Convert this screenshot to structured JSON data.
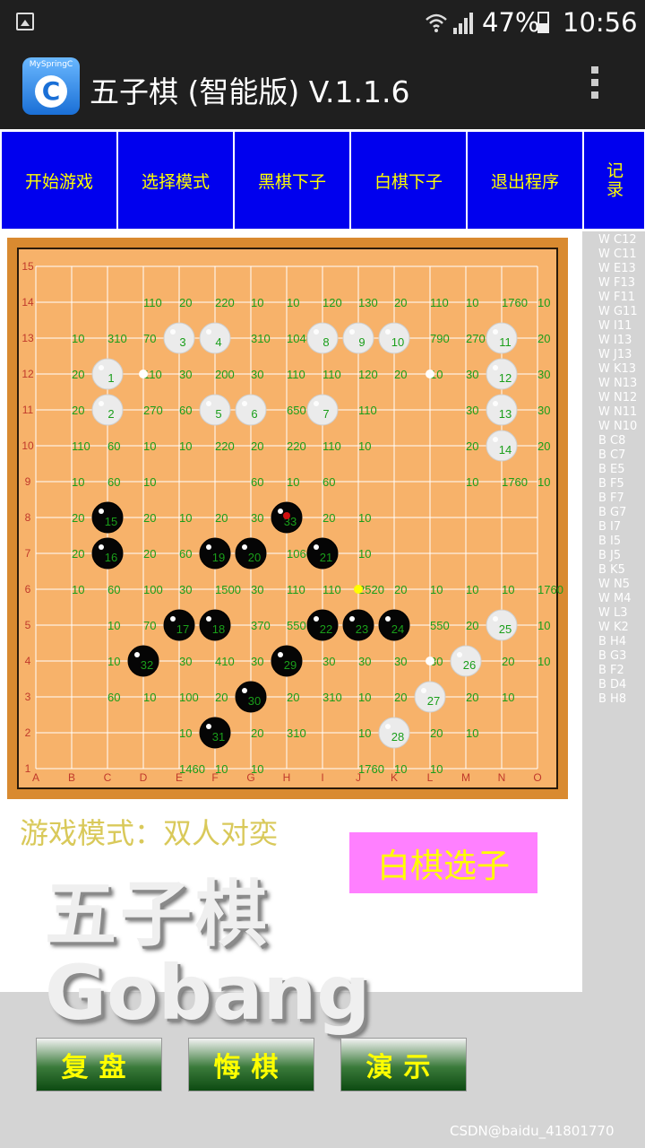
{
  "status_bar": {
    "battery": "47%",
    "time": "10:56",
    "battery_level": 0.47
  },
  "app_bar": {
    "logo_text": "MySpringC",
    "logo_letter": "C",
    "title": "五子棋 (智能版) V.1.1.6"
  },
  "toolbar": {
    "buttons": [
      {
        "label": "开始游戏"
      },
      {
        "label": "选择模式"
      },
      {
        "label": "黑棋下子"
      },
      {
        "label": "白棋下子"
      },
      {
        "label": "退出程序"
      },
      {
        "label": "记录"
      }
    ]
  },
  "board": {
    "col_labels": [
      "A",
      "B",
      "C",
      "D",
      "E",
      "F",
      "G",
      "H",
      "I",
      "J",
      "K",
      "L",
      "M",
      "N",
      "O"
    ],
    "row_labels": [
      "1",
      "2",
      "3",
      "4",
      "5",
      "6",
      "7",
      "8",
      "9",
      "10",
      "11",
      "12",
      "13",
      "14",
      "15"
    ],
    "colors": {
      "frame": "#d98a30",
      "surface": "#f7b26a",
      "grid": "#ffffff",
      "score": "#1a9e1a",
      "stone_label": "#1a9e1a",
      "coord": "#c0392b"
    },
    "white_stones": [
      {
        "n": "1",
        "col": "C",
        "row": 12
      },
      {
        "n": "2",
        "col": "C",
        "row": 11
      },
      {
        "n": "3",
        "col": "E",
        "row": 13
      },
      {
        "n": "4",
        "col": "F",
        "row": 13
      },
      {
        "n": "5",
        "col": "F",
        "row": 11
      },
      {
        "n": "6",
        "col": "G",
        "row": 11
      },
      {
        "n": "7",
        "col": "I",
        "row": 11
      },
      {
        "n": "8",
        "col": "I",
        "row": 13
      },
      {
        "n": "9",
        "col": "J",
        "row": 13
      },
      {
        "n": "10",
        "col": "K",
        "row": 13
      },
      {
        "n": "11",
        "col": "N",
        "row": 13
      },
      {
        "n": "12",
        "col": "N",
        "row": 12
      },
      {
        "n": "13",
        "col": "N",
        "row": 11
      },
      {
        "n": "14",
        "col": "N",
        "row": 10
      },
      {
        "n": "25",
        "col": "N",
        "row": 5
      },
      {
        "n": "26",
        "col": "M",
        "row": 4
      },
      {
        "n": "27",
        "col": "L",
        "row": 3
      },
      {
        "n": "28",
        "col": "K",
        "row": 2
      }
    ],
    "black_stones": [
      {
        "n": "15",
        "col": "C",
        "row": 8
      },
      {
        "n": "16",
        "col": "C",
        "row": 7
      },
      {
        "n": "17",
        "col": "E",
        "row": 5
      },
      {
        "n": "18",
        "col": "F",
        "row": 5
      },
      {
        "n": "19",
        "col": "F",
        "row": 7
      },
      {
        "n": "20",
        "col": "G",
        "row": 7
      },
      {
        "n": "21",
        "col": "I",
        "row": 7
      },
      {
        "n": "22",
        "col": "I",
        "row": 5
      },
      {
        "n": "23",
        "col": "J",
        "row": 5
      },
      {
        "n": "24",
        "col": "K",
        "row": 5
      },
      {
        "n": "29",
        "col": "H",
        "row": 4
      },
      {
        "n": "30",
        "col": "G",
        "row": 3
      },
      {
        "n": "31",
        "col": "F",
        "row": 2
      },
      {
        "n": "32",
        "col": "D",
        "row": 4
      },
      {
        "n": "33",
        "col": "H",
        "row": 8
      }
    ],
    "last_move": {
      "col": "H",
      "row": 8
    },
    "markers": [
      {
        "col": "D",
        "row": 12,
        "color": "#ffffff"
      },
      {
        "col": "L",
        "row": 12,
        "color": "#ffffff"
      },
      {
        "col": "L",
        "row": 4,
        "color": "#ffffff"
      },
      {
        "col": "J",
        "row": 6,
        "color": "#ffff00"
      }
    ],
    "scores": [
      [
        "D14",
        "110"
      ],
      [
        "E14",
        "20"
      ],
      [
        "F14",
        "220"
      ],
      [
        "G14",
        "10"
      ],
      [
        "H14",
        "10"
      ],
      [
        "I14",
        "120"
      ],
      [
        "J14",
        "130"
      ],
      [
        "K14",
        "20"
      ],
      [
        "L14",
        "110"
      ],
      [
        "M14",
        "10"
      ],
      [
        "N14",
        "1760"
      ],
      [
        "O14",
        "10"
      ],
      [
        "B13",
        "10"
      ],
      [
        "C13",
        "310"
      ],
      [
        "D13",
        "70"
      ],
      [
        "G13",
        "310"
      ],
      [
        "H13",
        "1040"
      ],
      [
        "L13",
        "790"
      ],
      [
        "M13",
        "270"
      ],
      [
        "O13",
        "20"
      ],
      [
        "B12",
        "20"
      ],
      [
        "D12",
        "110"
      ],
      [
        "E12",
        "30"
      ],
      [
        "F12",
        "200"
      ],
      [
        "G12",
        "30"
      ],
      [
        "H12",
        "110"
      ],
      [
        "I12",
        "110"
      ],
      [
        "J12",
        "120"
      ],
      [
        "K12",
        "20"
      ],
      [
        "L12",
        "10"
      ],
      [
        "M12",
        "30"
      ],
      [
        "O12",
        "30"
      ],
      [
        "B11",
        "20"
      ],
      [
        "D11",
        "270"
      ],
      [
        "E11",
        "60"
      ],
      [
        "H11",
        "650"
      ],
      [
        "J11",
        "110"
      ],
      [
        "M11",
        "30"
      ],
      [
        "O11",
        "30"
      ],
      [
        "B10",
        "110"
      ],
      [
        "C10",
        "60"
      ],
      [
        "D10",
        "10"
      ],
      [
        "E10",
        "10"
      ],
      [
        "F10",
        "220"
      ],
      [
        "G10",
        "20"
      ],
      [
        "H10",
        "220"
      ],
      [
        "I10",
        "110"
      ],
      [
        "J10",
        "10"
      ],
      [
        "M10",
        "20"
      ],
      [
        "O10",
        "20"
      ],
      [
        "B9",
        "10"
      ],
      [
        "C9",
        "60"
      ],
      [
        "D9",
        "10"
      ],
      [
        "G9",
        "60"
      ],
      [
        "H9",
        "10"
      ],
      [
        "I9",
        "60"
      ],
      [
        "M9",
        "10"
      ],
      [
        "N9",
        "1760"
      ],
      [
        "O9",
        "10"
      ],
      [
        "B8",
        "20"
      ],
      [
        "D8",
        "20"
      ],
      [
        "E8",
        "10"
      ],
      [
        "F8",
        "20"
      ],
      [
        "G8",
        "30"
      ],
      [
        "I8",
        "20"
      ],
      [
        "J8",
        "10"
      ],
      [
        "B7",
        "20"
      ],
      [
        "D7",
        "20"
      ],
      [
        "E7",
        "60"
      ],
      [
        "H7",
        "1060"
      ],
      [
        "J7",
        "10"
      ],
      [
        "B6",
        "10"
      ],
      [
        "C6",
        "60"
      ],
      [
        "D6",
        "100"
      ],
      [
        "E6",
        "30"
      ],
      [
        "F6",
        "1500"
      ],
      [
        "G6",
        "30"
      ],
      [
        "H6",
        "110"
      ],
      [
        "I6",
        "110"
      ],
      [
        "J6",
        "2520"
      ],
      [
        "K6",
        "20"
      ],
      [
        "L6",
        "10"
      ],
      [
        "M6",
        "10"
      ],
      [
        "N6",
        "10"
      ],
      [
        "O6",
        "1760"
      ],
      [
        "C5",
        "10"
      ],
      [
        "D5",
        "70"
      ],
      [
        "G5",
        "370"
      ],
      [
        "H5",
        "550"
      ],
      [
        "L5",
        "550"
      ],
      [
        "M5",
        "20"
      ],
      [
        "O5",
        "10"
      ],
      [
        "C4",
        "10"
      ],
      [
        "E4",
        "30"
      ],
      [
        "F4",
        "410"
      ],
      [
        "G4",
        "30"
      ],
      [
        "I4",
        "30"
      ],
      [
        "J4",
        "30"
      ],
      [
        "K4",
        "30"
      ],
      [
        "L4",
        "30"
      ],
      [
        "N4",
        "20"
      ],
      [
        "O4",
        "10"
      ],
      [
        "C3",
        "60"
      ],
      [
        "D3",
        "10"
      ],
      [
        "E3",
        "100"
      ],
      [
        "F3",
        "20"
      ],
      [
        "H3",
        "20"
      ],
      [
        "I3",
        "310"
      ],
      [
        "J3",
        "10"
      ],
      [
        "K3",
        "20"
      ],
      [
        "M3",
        "20"
      ],
      [
        "N3",
        "10"
      ],
      [
        "E2",
        "10"
      ],
      [
        "G2",
        "20"
      ],
      [
        "H2",
        "310"
      ],
      [
        "J2",
        "10"
      ],
      [
        "L2",
        "20"
      ],
      [
        "M2",
        "10"
      ],
      [
        "E1",
        "1460"
      ],
      [
        "F1",
        "10"
      ],
      [
        "G1",
        "10"
      ],
      [
        "J1",
        "1760"
      ],
      [
        "K1",
        "10"
      ],
      [
        "L1",
        "10"
      ]
    ]
  },
  "records": [
    "W C12",
    "W C11",
    "W E13",
    "W F13",
    "W F11",
    "W G11",
    "W I11",
    "W I13",
    "W J13",
    "W K13",
    "W N13",
    "W N12",
    "W N11",
    "W N10",
    "B C8",
    "B C7",
    "B E5",
    "B F5",
    "B F7",
    "B G7",
    "B I7",
    "B I5",
    "B J5",
    "B K5",
    "W N5",
    "W M4",
    "W L3",
    "W K2",
    "B H4",
    "B G3",
    "B F2",
    "B D4",
    "B H8"
  ],
  "mode_label": "游戏模式：双人对奕",
  "turn_status": "白棋选子",
  "big_title_cn": "五子棋",
  "big_title_en": "Gobang",
  "bottom_buttons": [
    {
      "label": "复盘"
    },
    {
      "label": "悔棋"
    },
    {
      "label": "演示"
    }
  ],
  "watermark": "CSDN@baidu_41801770"
}
